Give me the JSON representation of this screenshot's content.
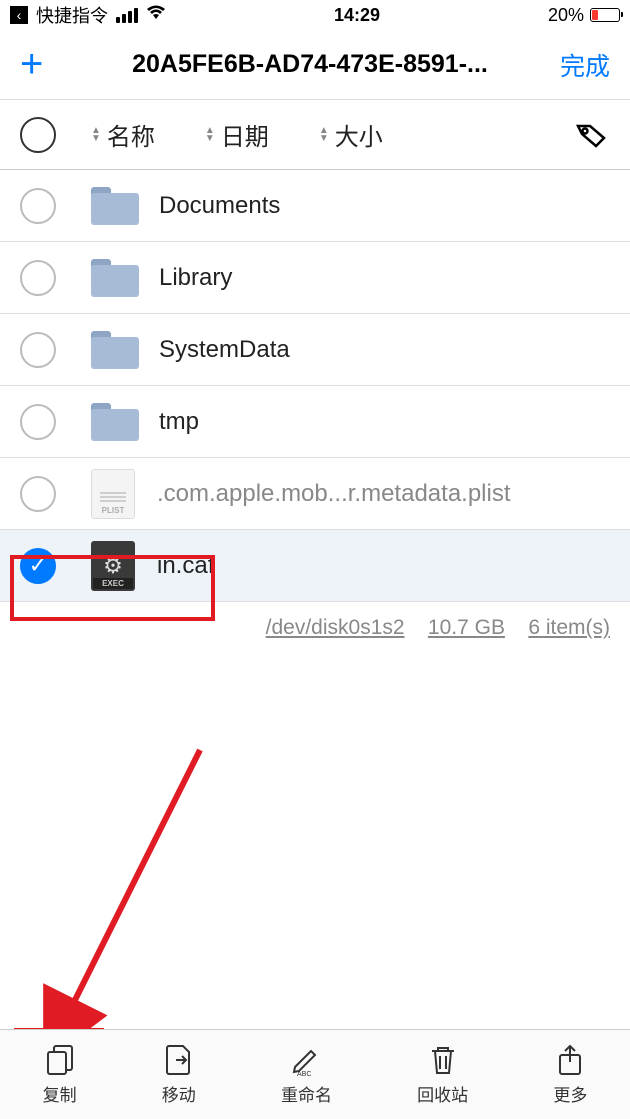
{
  "status": {
    "back_label": "快捷指令",
    "time": "14:29",
    "battery_pct": "20%"
  },
  "nav": {
    "title": "20A5FE6B-AD74-473E-8591-...",
    "done": "完成"
  },
  "sort": {
    "name": "名称",
    "date": "日期",
    "size": "大小"
  },
  "files": [
    {
      "name": "Documents",
      "type": "folder",
      "selected": false
    },
    {
      "name": "Library",
      "type": "folder",
      "selected": false
    },
    {
      "name": "SystemData",
      "type": "folder",
      "selected": false
    },
    {
      "name": "tmp",
      "type": "folder",
      "selected": false
    },
    {
      "name": ".com.apple.mob...r.metadata.plist",
      "type": "plist",
      "selected": false
    },
    {
      "name": "in.caf",
      "type": "exec",
      "selected": true
    }
  ],
  "footer": {
    "disk": "/dev/disk0s1s2",
    "space": "10.7 GB",
    "items": "6 item(s)"
  },
  "toolbar": {
    "copy": "复制",
    "move": "移动",
    "rename": "重命名",
    "trash": "回收站",
    "more": "更多"
  }
}
